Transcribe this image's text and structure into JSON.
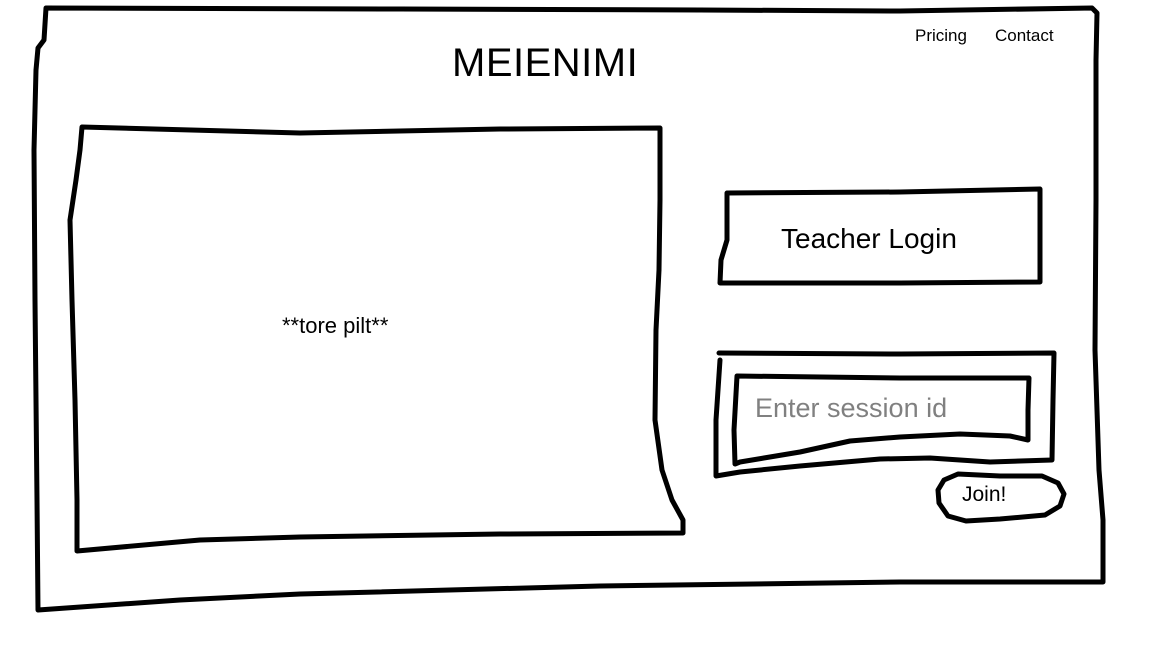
{
  "header": {
    "site_title": "MEIENIMI",
    "nav": [
      {
        "label": "Pricing"
      },
      {
        "label": "Contact"
      }
    ]
  },
  "hero": {
    "image_placeholder_label": "**tore pilt**"
  },
  "login": {
    "teacher_login_label": "Teacher Login",
    "session_input_value": "",
    "session_input_placeholder": "Enter session id",
    "join_label": "Join!"
  }
}
